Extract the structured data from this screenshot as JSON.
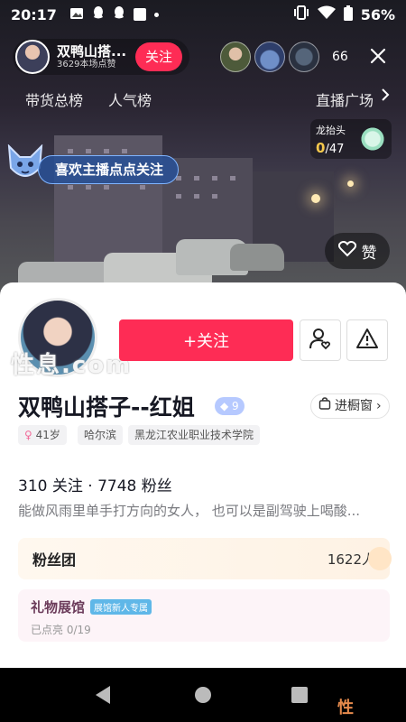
{
  "status_bar": {
    "time": "20:17",
    "battery": "56%"
  },
  "live": {
    "host_name": "双鸭山搭...",
    "host_likes": "3629本场点赞",
    "follow_label": "关注",
    "viewer_count": "66",
    "rank_tabs": [
      "带货总榜",
      "人气榜"
    ],
    "plaza_label": "直播广场",
    "task": {
      "title": "龙抬头",
      "current": "0",
      "total": "/47"
    },
    "tip_text": "喜欢主播点点关注",
    "like_label": "赞"
  },
  "profile": {
    "follow_label": "+关注",
    "nickname": "双鸭山搭子--红姐",
    "level": "9",
    "showcase_label": "进橱窗",
    "tags": {
      "age": "41岁",
      "city": "哈尔滨",
      "school": "黑龙江农业职业技术学院"
    },
    "stats": "310 关注 · 7748 粉丝",
    "bio": "能做风雨里单手打方向的女人， 也可以是副驾驶上喝酸...",
    "fan_club": {
      "title": "粉丝团",
      "count": "1622人"
    },
    "gift_hall": {
      "title": "礼物展馆",
      "badge": "展馆新人专属",
      "progress": "已点亮 0/19"
    }
  },
  "watermarks": {
    "overlay": "性息.com",
    "corner": "性息.com"
  },
  "icons": [
    "image-icon",
    "qq-icon",
    "vibrate-icon",
    "wifi-icon",
    "battery-icon",
    "close-icon",
    "heart-icon",
    "friend-icon",
    "report-icon",
    "shop-icon",
    "back-nav-icon",
    "home-nav-icon",
    "recent-nav-icon"
  ]
}
